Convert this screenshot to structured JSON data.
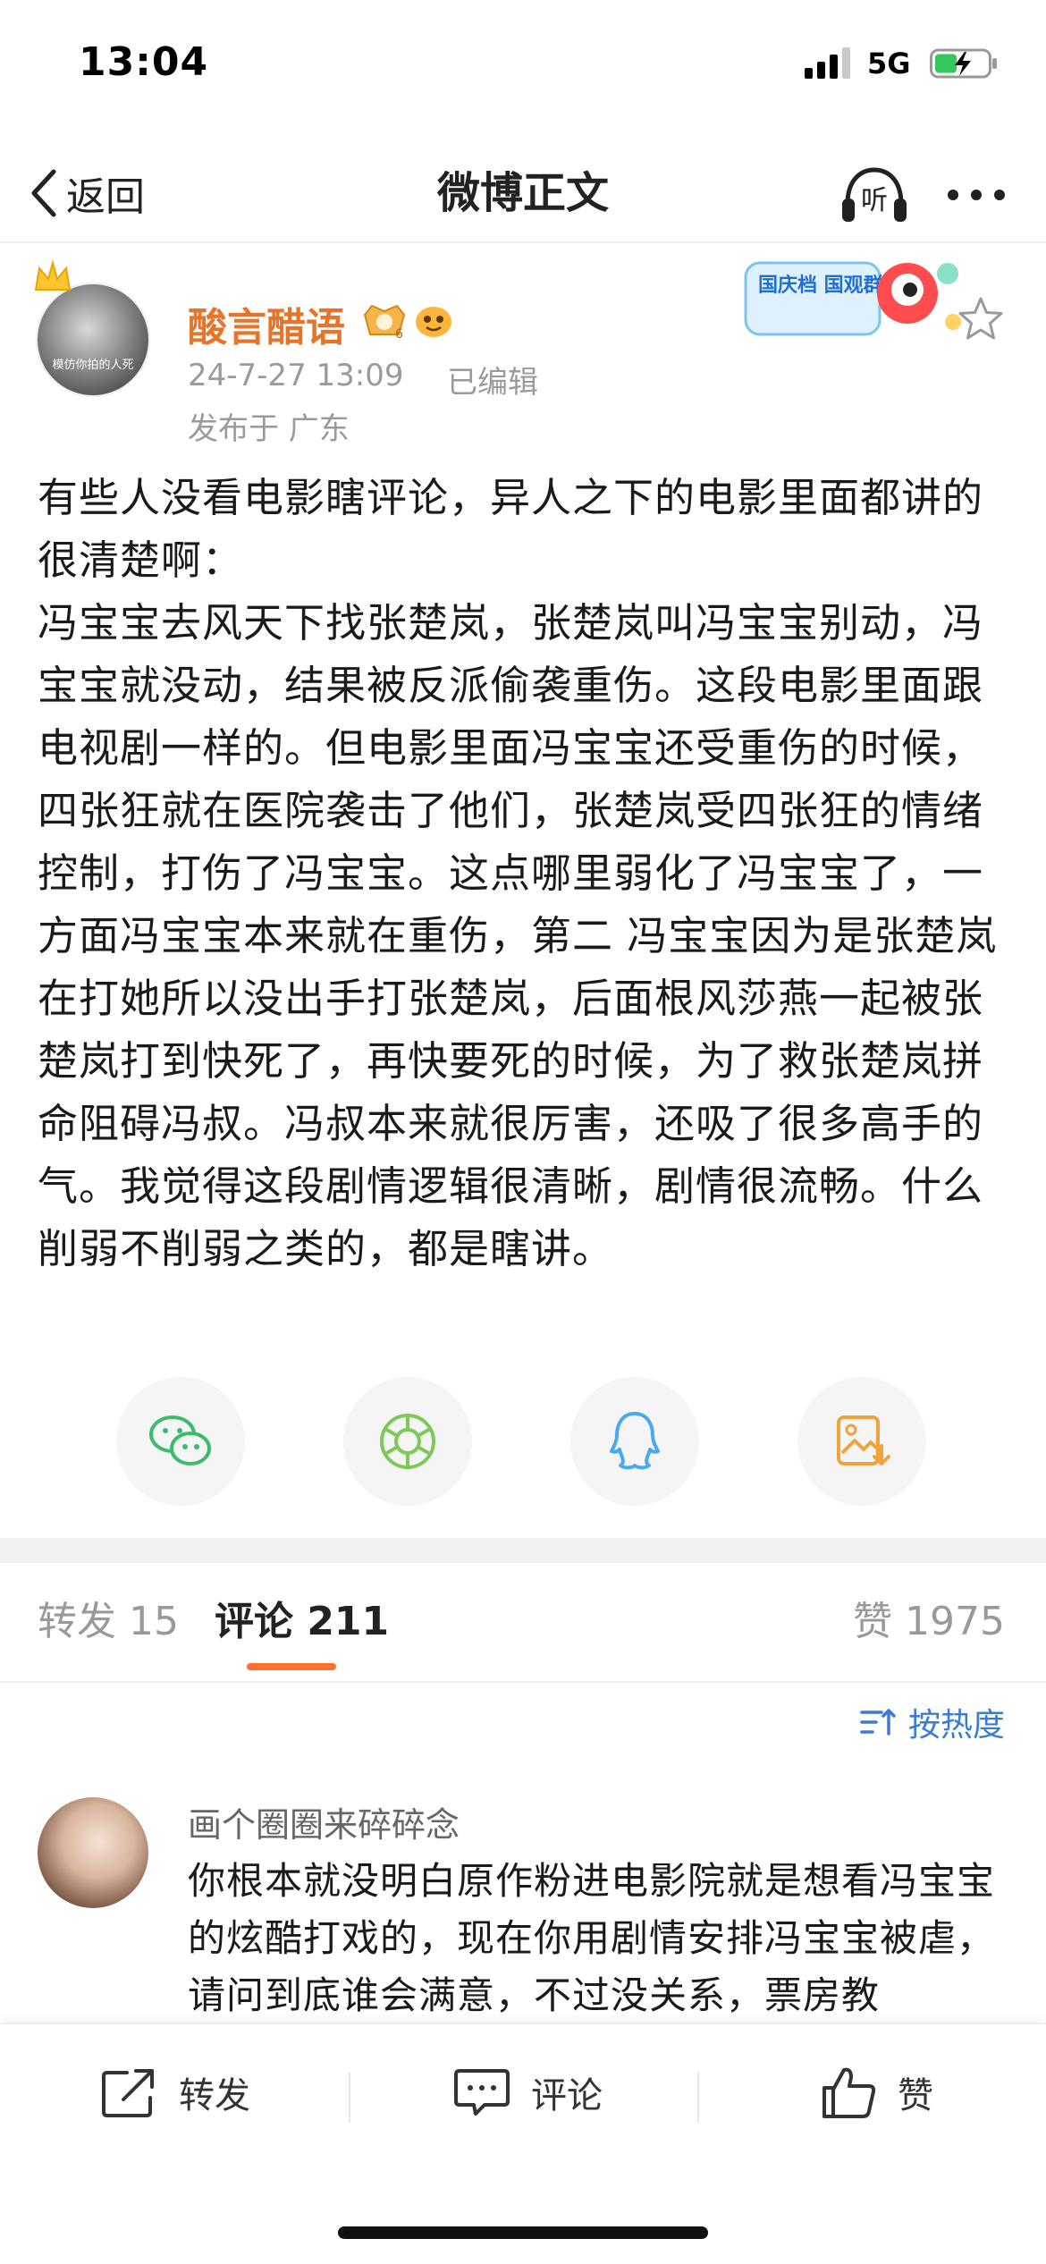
{
  "status_bar": {
    "time": "13:04",
    "network": "5G"
  },
  "nav": {
    "back_label": "返回",
    "title": "微博正文",
    "listen_label": "听"
  },
  "post": {
    "username": "酸言醋语",
    "time": "24-7-27 13:09",
    "edited": "已编辑",
    "location": "发布于 广东",
    "avatar_caption": "模仿你拍的人死",
    "promo_text": "国庆档 国观群众",
    "body": "有些人没看电影瞎评论，异人之下的电影里面都讲的很清楚啊：\n冯宝宝去风天下找张楚岚，张楚岚叫冯宝宝别动，冯宝宝就没动，结果被反派偷袭重伤。这段电影里面跟电视剧一样的。但电影里面冯宝宝还受重伤的时候，四张狂就在医院袭击了他们，张楚岚受四张狂的情绪控制，打伤了冯宝宝。这点哪里弱化了冯宝宝了，一方面冯宝宝本来就在重伤，第二 冯宝宝因为是张楚岚在打她所以没出手打张楚岚，后面根风莎燕一起被张楚岚打到快死了，再快要死的时候，为了救张楚岚拼命阻碍冯叔。冯叔本来就很厉害，还吸了很多高手的气。我觉得这段剧情逻辑很清晰，剧情很流畅。什么削弱不削弱之类的，都是瞎讲。"
  },
  "share": [
    {
      "icon": "wechat-icon"
    },
    {
      "icon": "moments-icon"
    },
    {
      "icon": "qq-icon"
    },
    {
      "icon": "save-image-icon"
    }
  ],
  "tabs": {
    "repost": "转发 15",
    "comment": "评论 211",
    "like": "赞 1975"
  },
  "sort_label": "按热度",
  "comment": {
    "username": "画个圈圈来碎碎念",
    "text": "你根本就没明白原作粉进电影院就是想看冯宝宝的炫酷打戏的，现在你用剧情安排冯宝宝被虐，请问到底谁会满意，不过没关系，票房教"
  },
  "bottom_bar": {
    "repost": "转发",
    "comment": "评论",
    "like": "赞"
  },
  "colors": {
    "accent": "#e8742a",
    "link": "#3b7bd1",
    "tab_indicator": "#ff6f2c"
  }
}
